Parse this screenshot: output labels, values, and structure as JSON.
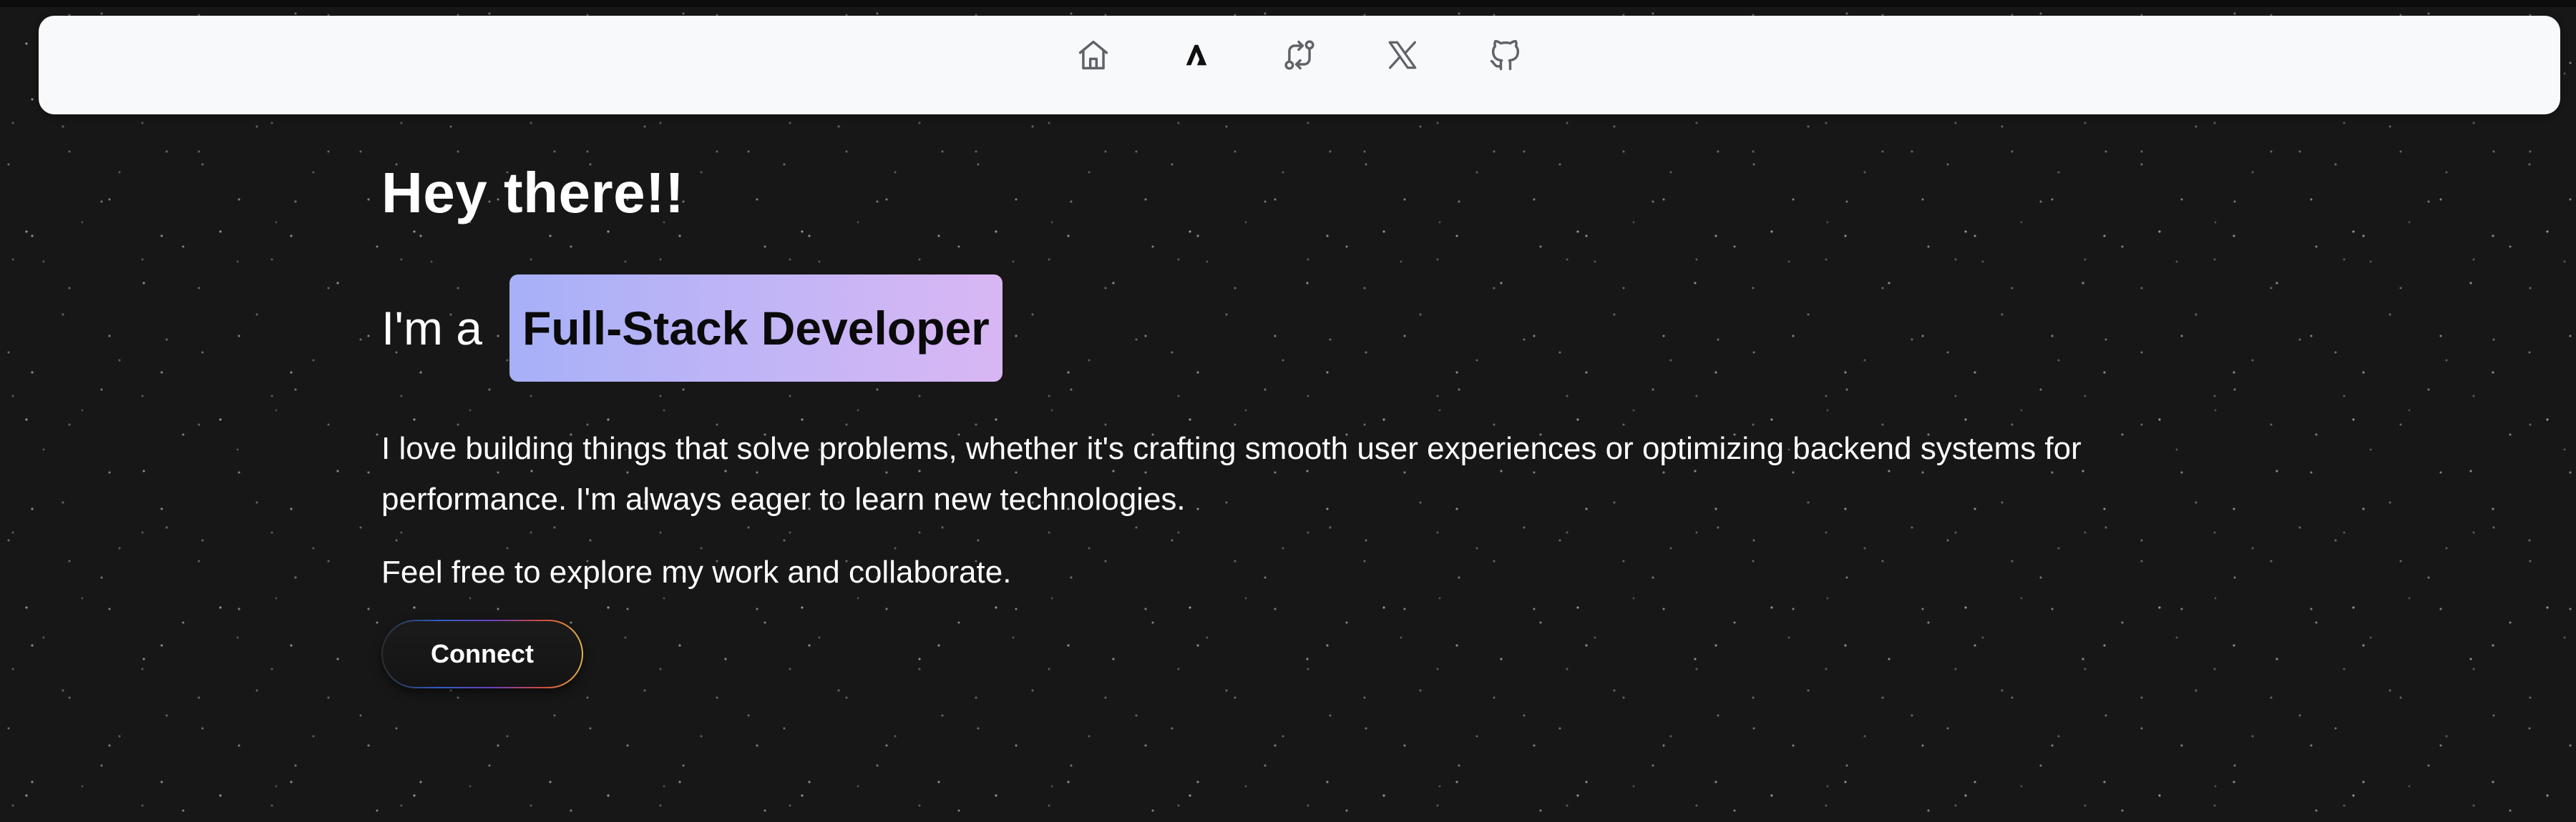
{
  "nav": {
    "items": [
      {
        "icon": "home-icon"
      },
      {
        "icon": "logo-icon",
        "active": true
      },
      {
        "icon": "git-compare-icon"
      },
      {
        "icon": "x-twitter-icon"
      },
      {
        "icon": "github-icon"
      }
    ]
  },
  "hero": {
    "greeting": "Hey there!!",
    "role_prefix": "I'm a",
    "role": "Full-Stack Developer",
    "bio": "I love building things that solve problems, whether it's crafting smooth user experiences or optimizing backend systems for performance. I'm always eager to learn new technologies.",
    "invite": "Feel free to explore my work and collaborate.",
    "cta_label": "Connect"
  },
  "colors": {
    "page_background": "#171717",
    "navbar_background": "#f8f9fb",
    "icon_color": "#5f6368",
    "badge_gradient_start": "#a7b0f7",
    "badge_gradient_end": "#d9b6f4"
  }
}
